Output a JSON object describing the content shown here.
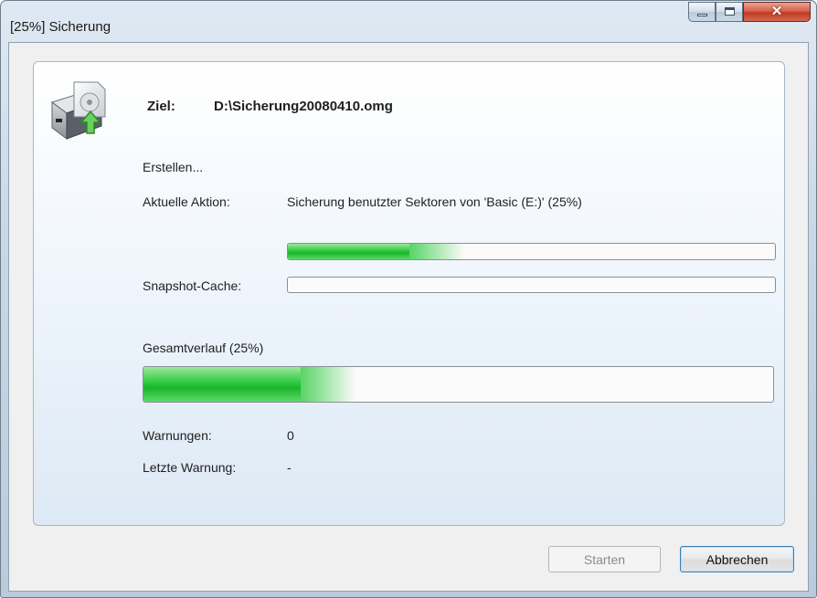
{
  "window": {
    "title": "[25%] Sicherung",
    "buttons": {
      "minimize": "minimize-icon",
      "maximize": "maximize-icon",
      "close": "close-icon"
    }
  },
  "header": {
    "icon": "backup-disk-icon",
    "target_label": "Ziel:",
    "target_value": "D:\\Sicherung20080410.omg"
  },
  "status": {
    "phase": "Erstellen...",
    "current_action_label": "Aktuelle Aktion:",
    "current_action_value": "Sicherung benutzter Sektoren von 'Basic (E:)' (25%)",
    "current_action_progress": 0.25,
    "snapshot_label": "Snapshot-Cache:",
    "snapshot_progress": 0.0
  },
  "overall": {
    "label": "Gesamtverlauf (25%)",
    "progress": 0.25
  },
  "warnings": {
    "count_label": "Warnungen:",
    "count_value": "0",
    "last_label": "Letzte Warnung:",
    "last_value": "-"
  },
  "footer": {
    "start_label": "Starten",
    "cancel_label": "Abbrechen"
  },
  "colors": {
    "progress_green": "#2fc93f",
    "title_close": "#c13a24"
  }
}
